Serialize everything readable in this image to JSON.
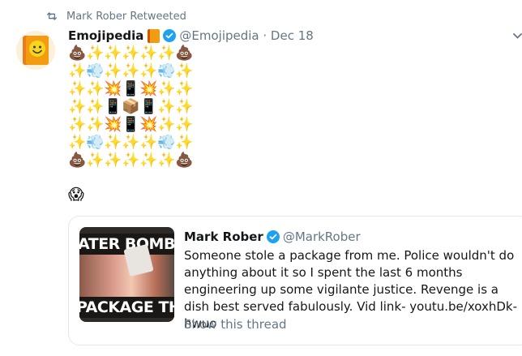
{
  "retweet": {
    "icon": "retweet-icon",
    "text": "Mark Rober Retweeted"
  },
  "tweet": {
    "author_name": "Emojipedia",
    "author_icon": "book-emoji-icon",
    "verified_icon": "verified-badge-icon",
    "handle_date": "@Emojipedia · Dec 18",
    "emoji_grid": [
      [
        "💩",
        "✨",
        "✨",
        "✨",
        "✨",
        "✨",
        "💩"
      ],
      [
        "✨",
        "💨",
        "✨",
        "✨",
        "✨",
        "💨",
        "✨"
      ],
      [
        "✨",
        "✨",
        "💥",
        "📱",
        "💥",
        "✨",
        "✨"
      ],
      [
        "✨",
        "✨",
        "📱",
        "📦",
        "📱",
        "✨",
        "✨"
      ],
      [
        "✨",
        "✨",
        "💥",
        "📱",
        "💥",
        "✨",
        "✨"
      ],
      [
        "✨",
        "💨",
        "✨",
        "✨",
        "✨",
        "💨",
        "✨"
      ],
      [
        "💩",
        "✨",
        "✨",
        "✨",
        "✨",
        "✨",
        "💩"
      ]
    ],
    "reaction_emoji": "😱"
  },
  "quoted": {
    "thumbnail_top": "ATER BOMB VS",
    "thumbnail_bottom": "PACKAGE THIEF",
    "author_name": "Mark Rober",
    "verified_icon": "verified-badge-icon",
    "handle": "@MarkRober",
    "text": "Someone stole a package from me. Police wouldn't do anything about it so I spent the last 6 months engineering up some vigilante justice. Revenge is a dish best served fabulously. Vid link- youtu.be/xoxhDk-hwuo",
    "show_thread": "Show this thread"
  },
  "colors": {
    "accent": "#1da1f2",
    "muted": "#657786",
    "border": "#e1e8ed"
  }
}
